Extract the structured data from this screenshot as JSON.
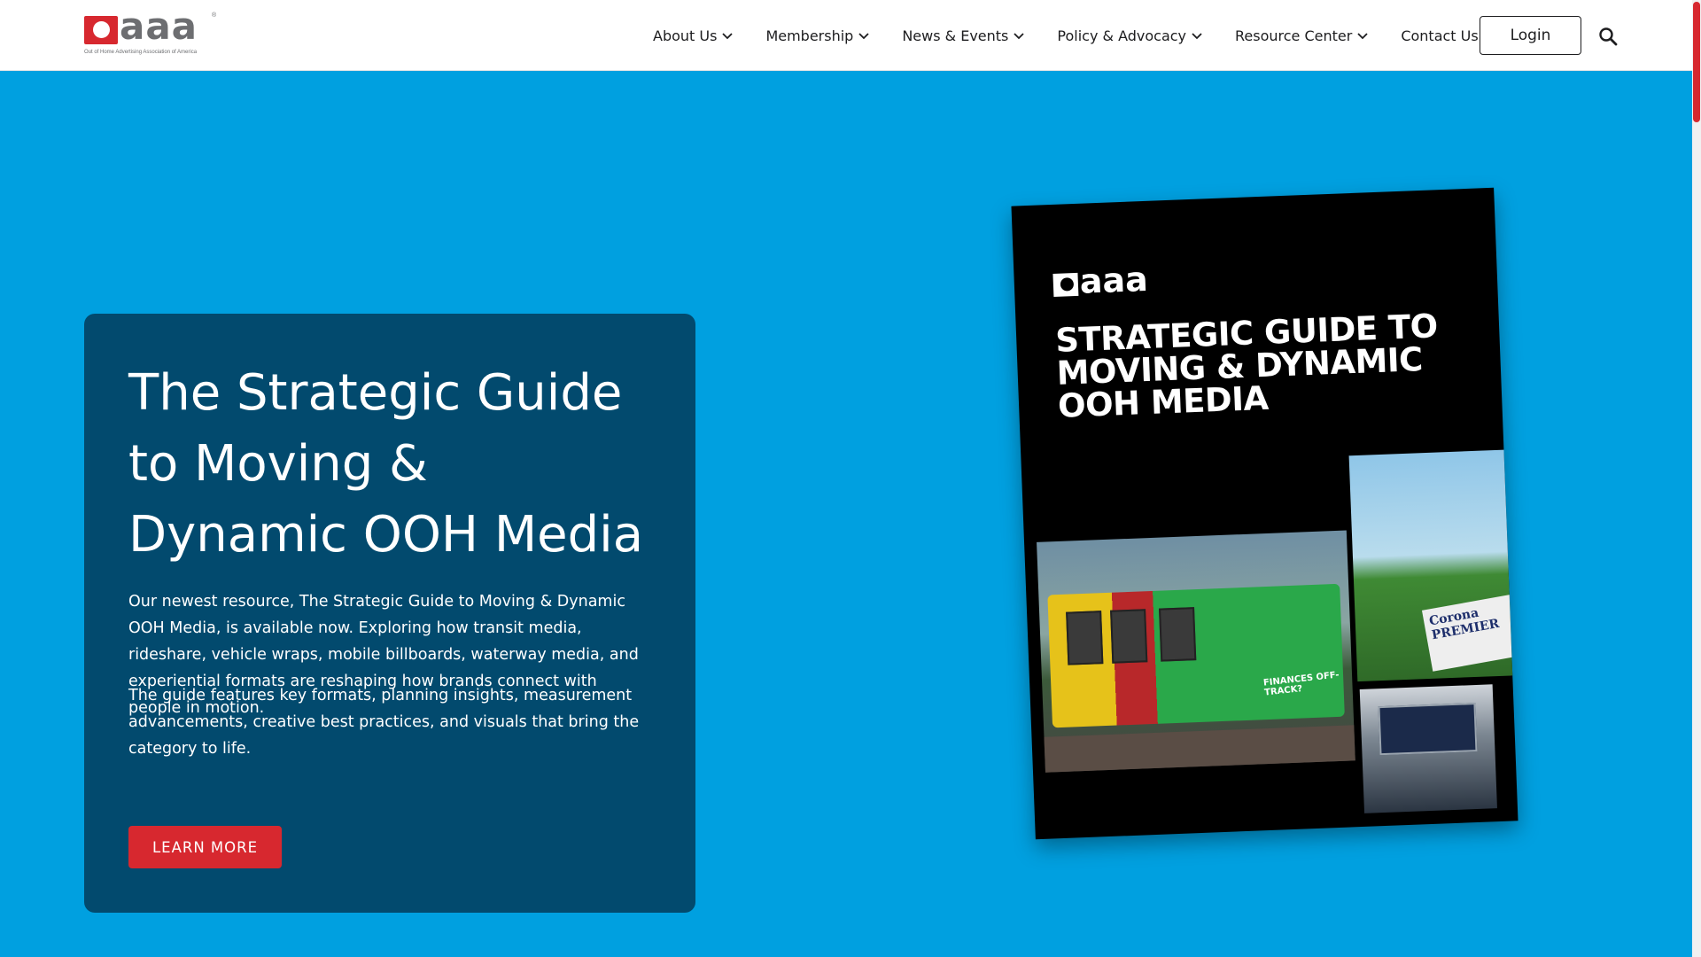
{
  "header": {
    "logo": {
      "wordmark": "aaa",
      "registered": "®",
      "tagline": "Out of Home Advertising Association of America",
      "brand_color": "#d7282f"
    },
    "nav": [
      {
        "label": "About Us",
        "has_dropdown": true,
        "icon": "chevron-down-icon"
      },
      {
        "label": "Membership",
        "has_dropdown": true,
        "icon": "chevron-down-icon"
      },
      {
        "label": "News & Events",
        "has_dropdown": true,
        "icon": "chevron-down-icon"
      },
      {
        "label": "Policy & Advocacy",
        "has_dropdown": true,
        "icon": "chevron-down-icon"
      },
      {
        "label": "Resource Center",
        "has_dropdown": true,
        "icon": "chevron-down-icon"
      },
      {
        "label": "Contact Us",
        "has_dropdown": false
      }
    ],
    "login_label": "Login",
    "search_icon": "search-icon"
  },
  "hero": {
    "background_color": "#00a0e0",
    "card_color": "#024a6e",
    "title": "The Strategic Guide to Moving & Dynamic OOH Media",
    "paragraph1": "Our newest resource, The Strategic Guide to Moving & Dynamic OOH Media, is available now. Exploring how transit media, rideshare, vehicle wraps, mobile billboards, waterway media, and experiential formats are reshaping how brands connect with people in motion.",
    "paragraph2": "The guide features key formats, planning insights, measurement advancements, creative best practices, and visuals that bring the category to life.",
    "cta_label": "LEARN MORE",
    "cta_color": "#d7282f",
    "cover": {
      "logo_text": "aaa",
      "title": "STRATEGIC GUIDE TO MOVING & DYNAMIC OOH MEDIA",
      "tram_caption": "FINANCES OFF-TRACK?",
      "golf_sign": "Corona PREMIER"
    },
    "carousel": {
      "prev_icon": "chevron-left-icon",
      "next_icon": "chevron-right-icon"
    }
  }
}
